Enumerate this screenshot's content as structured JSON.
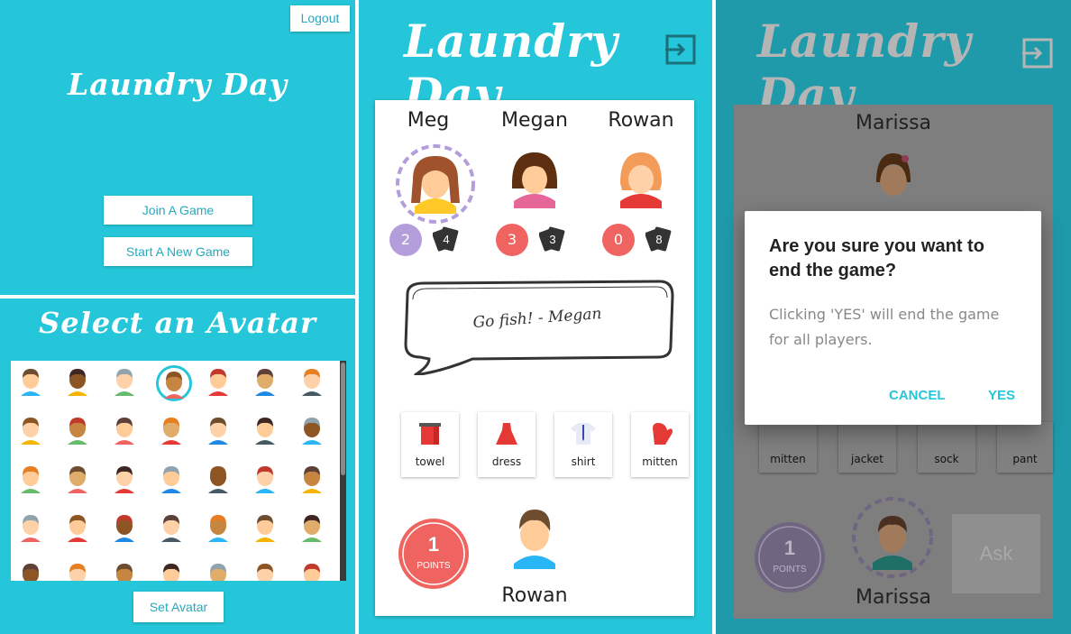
{
  "home": {
    "logout_label": "Logout",
    "title": "Laundry Day",
    "join_label": "Join A Game",
    "start_label": "Start A New Game"
  },
  "avatar_select": {
    "title": "Select an Avatar",
    "set_label": "Set Avatar"
  },
  "game": {
    "title": "Laundry Day",
    "opponents": [
      {
        "name": "Meg",
        "points": "2",
        "cards": "4",
        "badge_color": "#b39ddb"
      },
      {
        "name": "Megan",
        "points": "3",
        "cards": "3",
        "badge_color": "#ef6461"
      },
      {
        "name": "Rowan",
        "points": "0",
        "cards": "8",
        "badge_color": "#ef6461"
      }
    ],
    "message": "Go fish! - Megan",
    "hand": [
      "towel",
      "dress",
      "shirt",
      "mitten"
    ],
    "my_points": "1",
    "points_label": "POINTS",
    "my_name": "Rowan"
  },
  "end_game": {
    "title": "Laundry Day",
    "top_player": "Marissa",
    "hand": [
      "mitten",
      "jacket",
      "sock",
      "pant"
    ],
    "my_points": "1",
    "points_label": "POINTS",
    "ask_label": "Ask",
    "my_name": "Marissa",
    "dialog": {
      "title": "Are you sure you want to end the game?",
      "body": "Clicking 'YES' will end the game for all players.",
      "cancel_label": "CANCEL",
      "yes_label": "YES"
    }
  },
  "colors": {
    "accent": "#26c6da",
    "badge_red": "#ef6461",
    "badge_purple": "#b39ddb"
  }
}
